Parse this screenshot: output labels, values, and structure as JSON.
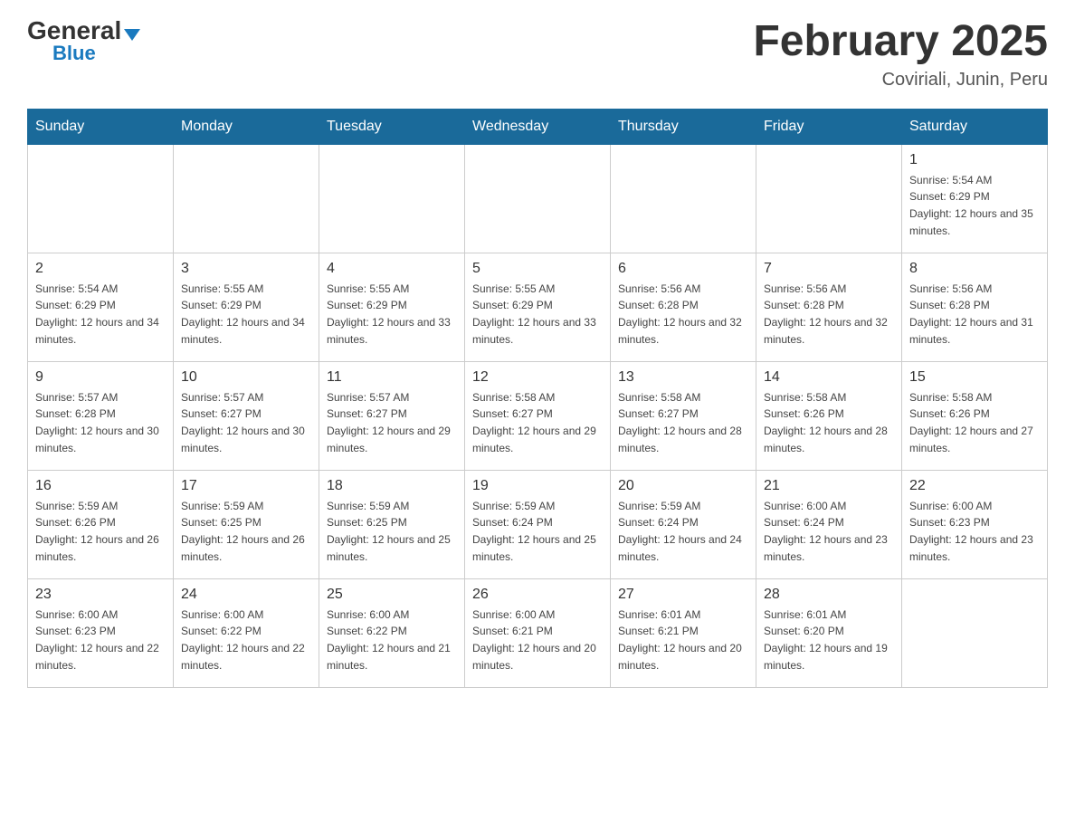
{
  "header": {
    "logo": {
      "general": "General",
      "blue": "Blue",
      "alt": "GeneralBlue logo"
    },
    "title": "February 2025",
    "location": "Coviriali, Junin, Peru"
  },
  "calendar": {
    "days_of_week": [
      "Sunday",
      "Monday",
      "Tuesday",
      "Wednesday",
      "Thursday",
      "Friday",
      "Saturday"
    ],
    "weeks": [
      [
        {
          "day": "",
          "info": ""
        },
        {
          "day": "",
          "info": ""
        },
        {
          "day": "",
          "info": ""
        },
        {
          "day": "",
          "info": ""
        },
        {
          "day": "",
          "info": ""
        },
        {
          "day": "",
          "info": ""
        },
        {
          "day": "1",
          "info": "Sunrise: 5:54 AM\nSunset: 6:29 PM\nDaylight: 12 hours and 35 minutes."
        }
      ],
      [
        {
          "day": "2",
          "info": "Sunrise: 5:54 AM\nSunset: 6:29 PM\nDaylight: 12 hours and 34 minutes."
        },
        {
          "day": "3",
          "info": "Sunrise: 5:55 AM\nSunset: 6:29 PM\nDaylight: 12 hours and 34 minutes."
        },
        {
          "day": "4",
          "info": "Sunrise: 5:55 AM\nSunset: 6:29 PM\nDaylight: 12 hours and 33 minutes."
        },
        {
          "day": "5",
          "info": "Sunrise: 5:55 AM\nSunset: 6:29 PM\nDaylight: 12 hours and 33 minutes."
        },
        {
          "day": "6",
          "info": "Sunrise: 5:56 AM\nSunset: 6:28 PM\nDaylight: 12 hours and 32 minutes."
        },
        {
          "day": "7",
          "info": "Sunrise: 5:56 AM\nSunset: 6:28 PM\nDaylight: 12 hours and 32 minutes."
        },
        {
          "day": "8",
          "info": "Sunrise: 5:56 AM\nSunset: 6:28 PM\nDaylight: 12 hours and 31 minutes."
        }
      ],
      [
        {
          "day": "9",
          "info": "Sunrise: 5:57 AM\nSunset: 6:28 PM\nDaylight: 12 hours and 30 minutes."
        },
        {
          "day": "10",
          "info": "Sunrise: 5:57 AM\nSunset: 6:27 PM\nDaylight: 12 hours and 30 minutes."
        },
        {
          "day": "11",
          "info": "Sunrise: 5:57 AM\nSunset: 6:27 PM\nDaylight: 12 hours and 29 minutes."
        },
        {
          "day": "12",
          "info": "Sunrise: 5:58 AM\nSunset: 6:27 PM\nDaylight: 12 hours and 29 minutes."
        },
        {
          "day": "13",
          "info": "Sunrise: 5:58 AM\nSunset: 6:27 PM\nDaylight: 12 hours and 28 minutes."
        },
        {
          "day": "14",
          "info": "Sunrise: 5:58 AM\nSunset: 6:26 PM\nDaylight: 12 hours and 28 minutes."
        },
        {
          "day": "15",
          "info": "Sunrise: 5:58 AM\nSunset: 6:26 PM\nDaylight: 12 hours and 27 minutes."
        }
      ],
      [
        {
          "day": "16",
          "info": "Sunrise: 5:59 AM\nSunset: 6:26 PM\nDaylight: 12 hours and 26 minutes."
        },
        {
          "day": "17",
          "info": "Sunrise: 5:59 AM\nSunset: 6:25 PM\nDaylight: 12 hours and 26 minutes."
        },
        {
          "day": "18",
          "info": "Sunrise: 5:59 AM\nSunset: 6:25 PM\nDaylight: 12 hours and 25 minutes."
        },
        {
          "day": "19",
          "info": "Sunrise: 5:59 AM\nSunset: 6:24 PM\nDaylight: 12 hours and 25 minutes."
        },
        {
          "day": "20",
          "info": "Sunrise: 5:59 AM\nSunset: 6:24 PM\nDaylight: 12 hours and 24 minutes."
        },
        {
          "day": "21",
          "info": "Sunrise: 6:00 AM\nSunset: 6:24 PM\nDaylight: 12 hours and 23 minutes."
        },
        {
          "day": "22",
          "info": "Sunrise: 6:00 AM\nSunset: 6:23 PM\nDaylight: 12 hours and 23 minutes."
        }
      ],
      [
        {
          "day": "23",
          "info": "Sunrise: 6:00 AM\nSunset: 6:23 PM\nDaylight: 12 hours and 22 minutes."
        },
        {
          "day": "24",
          "info": "Sunrise: 6:00 AM\nSunset: 6:22 PM\nDaylight: 12 hours and 22 minutes."
        },
        {
          "day": "25",
          "info": "Sunrise: 6:00 AM\nSunset: 6:22 PM\nDaylight: 12 hours and 21 minutes."
        },
        {
          "day": "26",
          "info": "Sunrise: 6:00 AM\nSunset: 6:21 PM\nDaylight: 12 hours and 20 minutes."
        },
        {
          "day": "27",
          "info": "Sunrise: 6:01 AM\nSunset: 6:21 PM\nDaylight: 12 hours and 20 minutes."
        },
        {
          "day": "28",
          "info": "Sunrise: 6:01 AM\nSunset: 6:20 PM\nDaylight: 12 hours and 19 minutes."
        },
        {
          "day": "",
          "info": ""
        }
      ]
    ]
  }
}
